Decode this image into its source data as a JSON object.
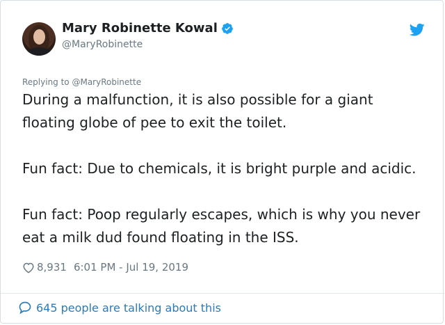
{
  "author": {
    "display_name": "Mary Robinette Kowal",
    "handle": "@MaryRobinette",
    "verified_icon": "verified-badge-icon",
    "avatar_icon": "profile-avatar"
  },
  "brand": {
    "icon": "twitter-bird-icon",
    "color": "#1da1f2"
  },
  "reply": {
    "text": "Replying to @MaryRobinette"
  },
  "tweet": {
    "paragraphs": [
      "During a malfunction, it is also possible for a giant floating globe of pee to exit the toilet.",
      "Fun fact: Due to chemicals, it is bright purple and acidic.",
      "Fun fact: Poop regularly escapes, which is why you never eat a milk dud found floating in the ISS."
    ]
  },
  "meta": {
    "heart_icon": "heart-icon",
    "likes": "8,931",
    "timestamp": "6:01 PM - Jul 19, 2019"
  },
  "footer": {
    "bubble_icon": "speech-bubble-icon",
    "talking_text": "645 people are talking about this",
    "link_color": "#2b7bb9"
  },
  "colors": {
    "text_primary": "#1c2022",
    "text_secondary": "#697882",
    "border": "#d6dde3"
  }
}
